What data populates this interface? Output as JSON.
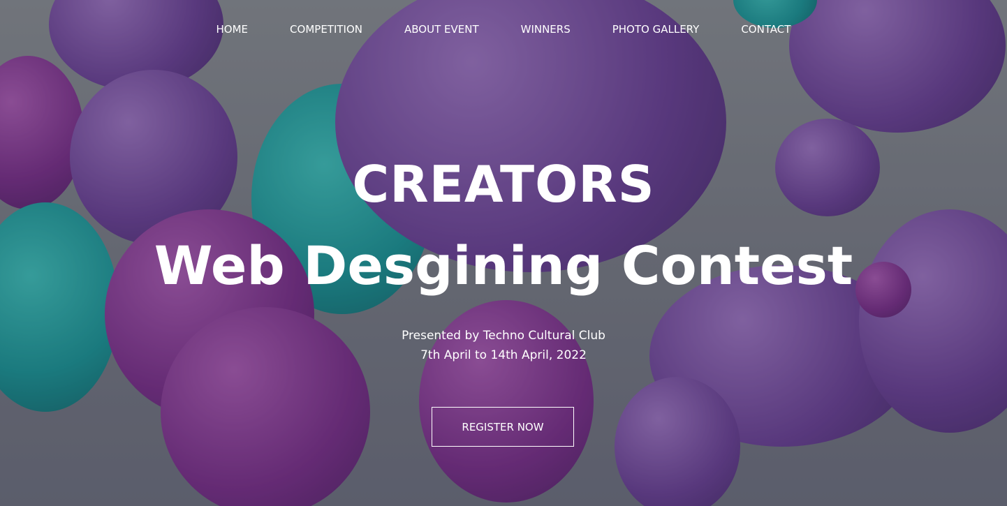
{
  "nav": {
    "items": [
      "HOME",
      "COMPETITION",
      "ABOUT EVENT",
      "WINNERS",
      "PHOTO GALLERY",
      "CONTACT"
    ]
  },
  "hero": {
    "title": "CREATORS",
    "subtitle": "Web Desgining Contest",
    "presenter": "Presented by Techno Cultural Club",
    "dates": "7th April to 14th April, 2022",
    "register_label": "REGISTER NOW"
  },
  "colors": {
    "purple": "#7c2c8c",
    "violet": "#6b3f98",
    "teal": "#169a9a"
  }
}
